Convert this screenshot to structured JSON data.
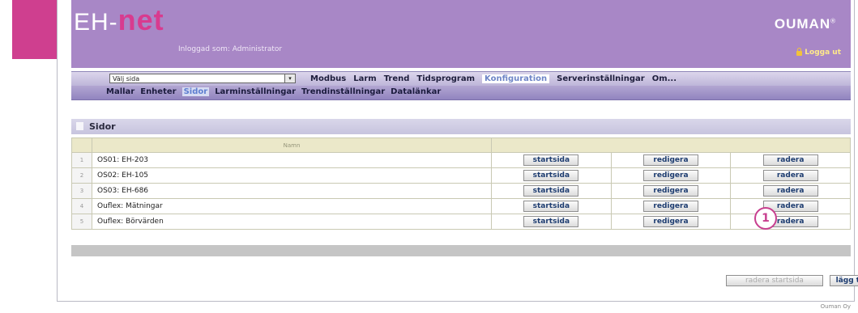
{
  "header": {
    "logo_prefix": "EH-",
    "logo_main": "net",
    "logged_in": "Inloggad som: Administrator",
    "brand": "OUMAN",
    "brand_mark": "®",
    "logout": "Logga ut",
    "logout_icon": "lock-icon"
  },
  "nav": {
    "select_value": "Välj sida",
    "select_arrow": "▾",
    "main": [
      {
        "label": "Modbus",
        "active": false
      },
      {
        "label": "Larm",
        "active": false
      },
      {
        "label": "Trend",
        "active": false
      },
      {
        "label": "Tidsprogram",
        "active": false
      },
      {
        "label": "Konfiguration",
        "active": true
      },
      {
        "label": "Serverinställningar",
        "active": false
      },
      {
        "label": "Om...",
        "active": false
      }
    ],
    "sub": [
      {
        "label": "Mallar",
        "active": false
      },
      {
        "label": "Enheter",
        "active": false
      },
      {
        "label": "Sidor",
        "active": true
      },
      {
        "label": "Larminställningar",
        "active": false
      },
      {
        "label": "Trendinställningar",
        "active": false
      },
      {
        "label": "Datalänkar",
        "active": false
      }
    ]
  },
  "panel": {
    "title": "Sidor",
    "column_name": "Namn",
    "rows": [
      {
        "num": "1",
        "name": "OS01: EH-203"
      },
      {
        "num": "2",
        "name": "OS02: EH-105"
      },
      {
        "num": "3",
        "name": "OS03: EH-686"
      },
      {
        "num": "4",
        "name": "Ouflex: Mätningar"
      },
      {
        "num": "5",
        "name": "Ouflex: Börvärden"
      }
    ],
    "btn_start": "startsida",
    "btn_edit": "redigera",
    "btn_delete": "radera"
  },
  "badge": "1",
  "bottom": {
    "remove_start": "radera startsida",
    "add": "lägg till"
  },
  "footer": "Ouman Oy",
  "colors": {
    "header": "#a887c6",
    "pink": "#cf3f8f",
    "active_text": "#6f86c7"
  }
}
